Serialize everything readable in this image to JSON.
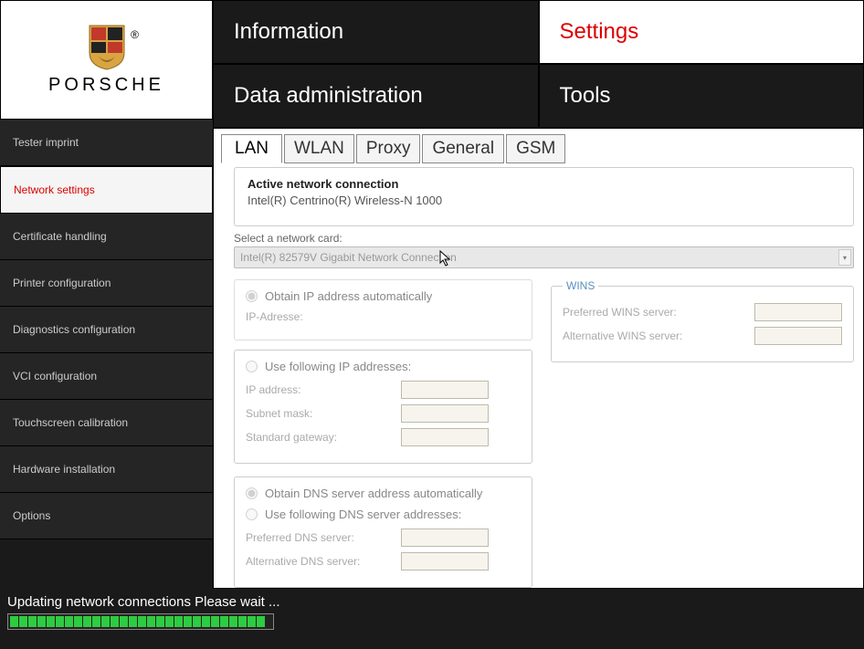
{
  "brand": {
    "name": "PORSCHE"
  },
  "topnav": {
    "information": "Information",
    "settings": "Settings",
    "data_admin": "Data administration",
    "tools": "Tools"
  },
  "sidebar": {
    "items": [
      "Tester imprint",
      "Network settings",
      "Certificate handling",
      "Printer configuration",
      "Diagnostics configuration",
      "VCI configuration",
      "Touchscreen calibration",
      "Hardware installation",
      "Options"
    ]
  },
  "tabs": [
    "LAN",
    "WLAN",
    "Proxy",
    "General",
    "GSM"
  ],
  "active_connection": {
    "title": "Active network connection",
    "value": "Intel(R) Centrino(R) Wireless-N 1000"
  },
  "network_card": {
    "label": "Select a network card:",
    "selected": "Intel(R) 82579V Gigabit Network Connection"
  },
  "ip": {
    "auto": "Obtain IP address automatically",
    "ip_adresse": "IP-Adresse:",
    "manual": "Use following IP addresses:",
    "ip_address": "IP address:",
    "subnet": "Subnet mask:",
    "gateway": "Standard gateway:"
  },
  "wins": {
    "legend": "WINS",
    "preferred": "Preferred WINS server:",
    "alternative": "Alternative WINS server:"
  },
  "dns": {
    "auto": "Obtain DNS server address automatically",
    "manual": "Use following DNS server addresses:",
    "preferred": "Preferred DNS server:",
    "alternative": "Alternative DNS server:"
  },
  "status": "Updating network connections Please wait ..."
}
